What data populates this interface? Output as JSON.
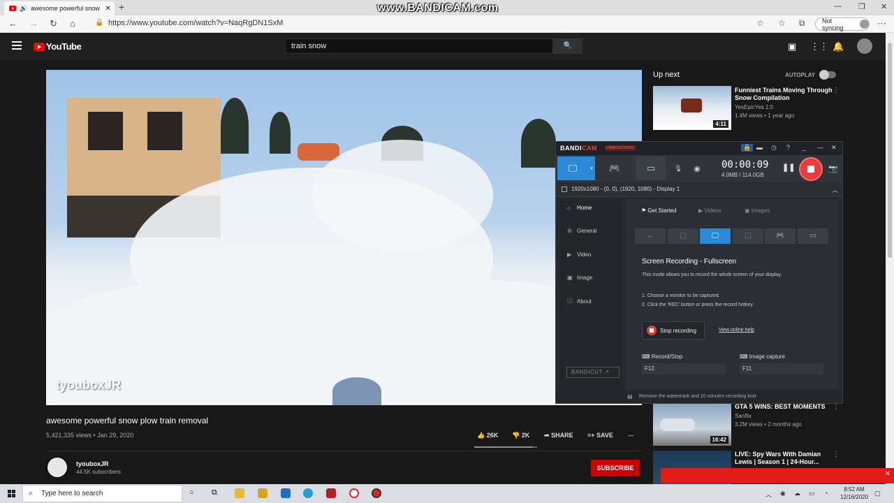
{
  "browser": {
    "tab_title": "awesome powerful snow pl",
    "tab_close": "✕",
    "new_tab": "+",
    "url": "https://www.youtube.com/watch?v=NaqRgDN1SxM",
    "not_syncing": "Not syncing",
    "watermark": "www.BANDICAM.com"
  },
  "youtube": {
    "logo_text": "YouTube",
    "search_value": "train snow",
    "video": {
      "channel_watermark": "tyouboxJR",
      "title": "awesome powerful snow plow train removal",
      "views_date": "5,421,335 views • Jan 29, 2020",
      "likes": "26K",
      "dislikes": "2K",
      "share": "SHARE",
      "save": "SAVE",
      "like_ratio": 0.93
    },
    "channel": {
      "name": "tyouboxJR",
      "subscribers": "44.5K subscribers",
      "subscribe": "SUBSCRIBE"
    },
    "sidebar": {
      "up_next": "Up next",
      "autoplay": "AUTOPLAY",
      "items": [
        {
          "title": "Funniest Trains Moving Through Snow Compilation",
          "channel": "YesEpicYes 2.0",
          "meta": "1.4M views • 1 year ago",
          "duration": "4:11"
        },
        {
          "title": "GTA 5 WINS: BEST MOMENTS",
          "channel": "Sanflix",
          "meta": "3.2M views • 2 months ago",
          "duration": "16:42"
        },
        {
          "title": "LIVE: Spy Wars With Damian Lewis | Season 1 | 24-Hour...",
          "channel": "",
          "meta": "",
          "duration": ""
        }
      ]
    }
  },
  "bandicam": {
    "logo_a": "BANDI",
    "logo_b": "CAM",
    "unregistered": "UNREGISTERED",
    "timer": "00:00:09",
    "size": "4.0MB / 114.0GB",
    "display": "1920x1080 - (0, 0), (1920, 1080) - Display 1",
    "nav": [
      "Home",
      "General",
      "Video",
      "Image",
      "About"
    ],
    "tabs": [
      "Get Started",
      "Videos",
      "Images"
    ],
    "heading": "Screen Recording - Fullscreen",
    "description": "This mode allows you to record the whole screen of your display.",
    "step1": "1. Choose a monitor to be captured.",
    "step2": "2. Click the 'REC' button or press the record hotkey.",
    "stop_recording": "Stop recording",
    "online_help": "View online help",
    "record_stop_label": "Record/Stop",
    "record_stop_key": "F12",
    "image_capture_label": "Image capture",
    "image_capture_key": "F11",
    "bandicut": "BANDICUT ↗",
    "footer": "Remove the watermark and 10 minutes recording limit"
  },
  "taskbar": {
    "search_placeholder": "Type here to search",
    "time": "8:52 AM",
    "date": "12/16/2020"
  }
}
